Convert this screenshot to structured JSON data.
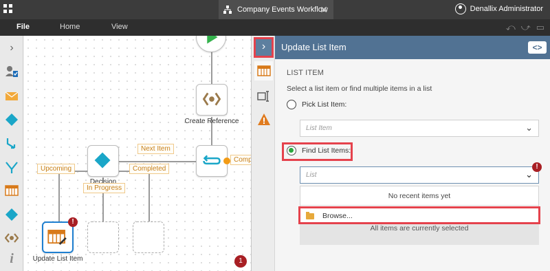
{
  "titlebar": {
    "workflow_tab": "Company Events Workflow",
    "user_name": "Denallix Administrator"
  },
  "menubar": {
    "file": "File",
    "home": "Home",
    "view": "View"
  },
  "canvas": {
    "create_reference_label": "Create Reference",
    "decision_label": "Decision",
    "update_list_item_label": "Update List Item",
    "tags": {
      "next_item": "Next Item",
      "completed": "Completed",
      "upcoming": "Upcoming",
      "in_progress": "In Progress",
      "comp": "Comp"
    },
    "error_badge": "!",
    "count_badge": "1"
  },
  "panel": {
    "title": "Update List Item",
    "header_button": "<>",
    "section_title": "LIST ITEM",
    "description": "Select a list item or find multiple items in a list",
    "pick_label": "Pick List Item:",
    "pick_placeholder": "List Item",
    "find_label": "Find List Items:",
    "list_placeholder": "List",
    "no_recent": "No recent items yet",
    "browse": "Browse...",
    "all_selected": "All items are currently selected",
    "selected_option": "find"
  },
  "colors": {
    "header_blue": "#517293",
    "highlight_red": "#e5424c",
    "accent_teal": "#1aa6c8",
    "orange": "#f29b16"
  }
}
